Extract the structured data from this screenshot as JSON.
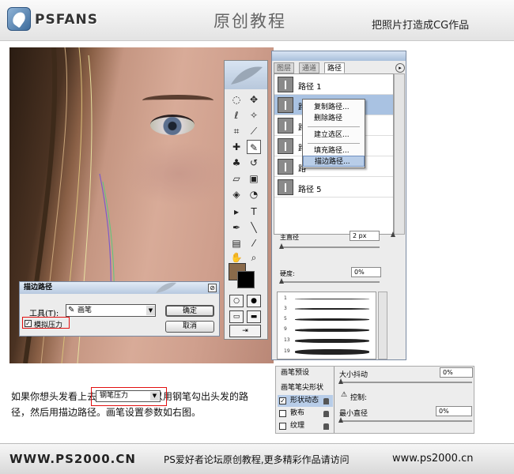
{
  "header": {
    "logo_text": "PSFANS",
    "title": "原创教程",
    "subtitle": "把照片打造成CG作品"
  },
  "paths_panel": {
    "tabs": [
      "图层",
      "通道",
      "路径"
    ],
    "active_tab": "路径",
    "paths": [
      {
        "name": "路径 1",
        "selected": false
      },
      {
        "name": "路径 2",
        "selected": true
      },
      {
        "name": "路",
        "selected": false
      },
      {
        "name": "路",
        "selected": false
      },
      {
        "name": "路",
        "selected": false
      },
      {
        "name": "路径 5",
        "selected": false
      }
    ],
    "context_menu": [
      "复制路径...",
      "删除路径",
      "建立选区...",
      "填充路径...",
      "描边路径..."
    ],
    "highlighted_item": "描边路径...",
    "brush": {
      "master_diameter_label": "主直径",
      "master_diameter_value": "2 px",
      "hardness_label": "硬度:",
      "hardness_value": "0%",
      "preset_numbers": [
        "1",
        "3",
        "5",
        "9",
        "13",
        "19"
      ]
    }
  },
  "stroke_dialog": {
    "title": "描边路径",
    "tool_label": "工具(T):",
    "tool_value": "画笔",
    "simulate_pressure_label": "模拟压力",
    "simulate_pressure_checked": "✓",
    "ok_label": "确定",
    "cancel_label": "取消"
  },
  "caption": "如果你想头发看上去更飘逸，也可以用钢笔勾出头发的路径，然后用描边路径。画笔设置参数如右图。",
  "brush_dynamics": {
    "menu": [
      {
        "label": "画笔预设",
        "checkbox": false,
        "checked": "",
        "locked": false,
        "active": false
      },
      {
        "label": "画笔笔尖形状",
        "checkbox": false,
        "checked": "",
        "locked": false,
        "active": false
      },
      {
        "label": "形状动态",
        "checkbox": true,
        "checked": "✓",
        "locked": true,
        "active": true
      },
      {
        "label": "散布",
        "checkbox": true,
        "checked": "",
        "locked": true,
        "active": false
      },
      {
        "label": "纹理",
        "checkbox": true,
        "checked": "",
        "locked": true,
        "active": false
      }
    ],
    "size_jitter_label": "大小抖动",
    "size_jitter_value": "0%",
    "control_label": "控制:",
    "control_value": "钢笔压力",
    "min_diameter_label": "最小直径",
    "min_diameter_value": "0%"
  },
  "footer": {
    "left": "WWW.PS2000.CN",
    "middle": "PS爱好者论坛原创教程,更多精彩作品请访问",
    "right": "www.ps2000.cn"
  },
  "colors": {
    "foreground": "#8a6a4a",
    "background": "#000000",
    "highlight_frame": "#e21010",
    "selection": "#a9c2e2"
  }
}
